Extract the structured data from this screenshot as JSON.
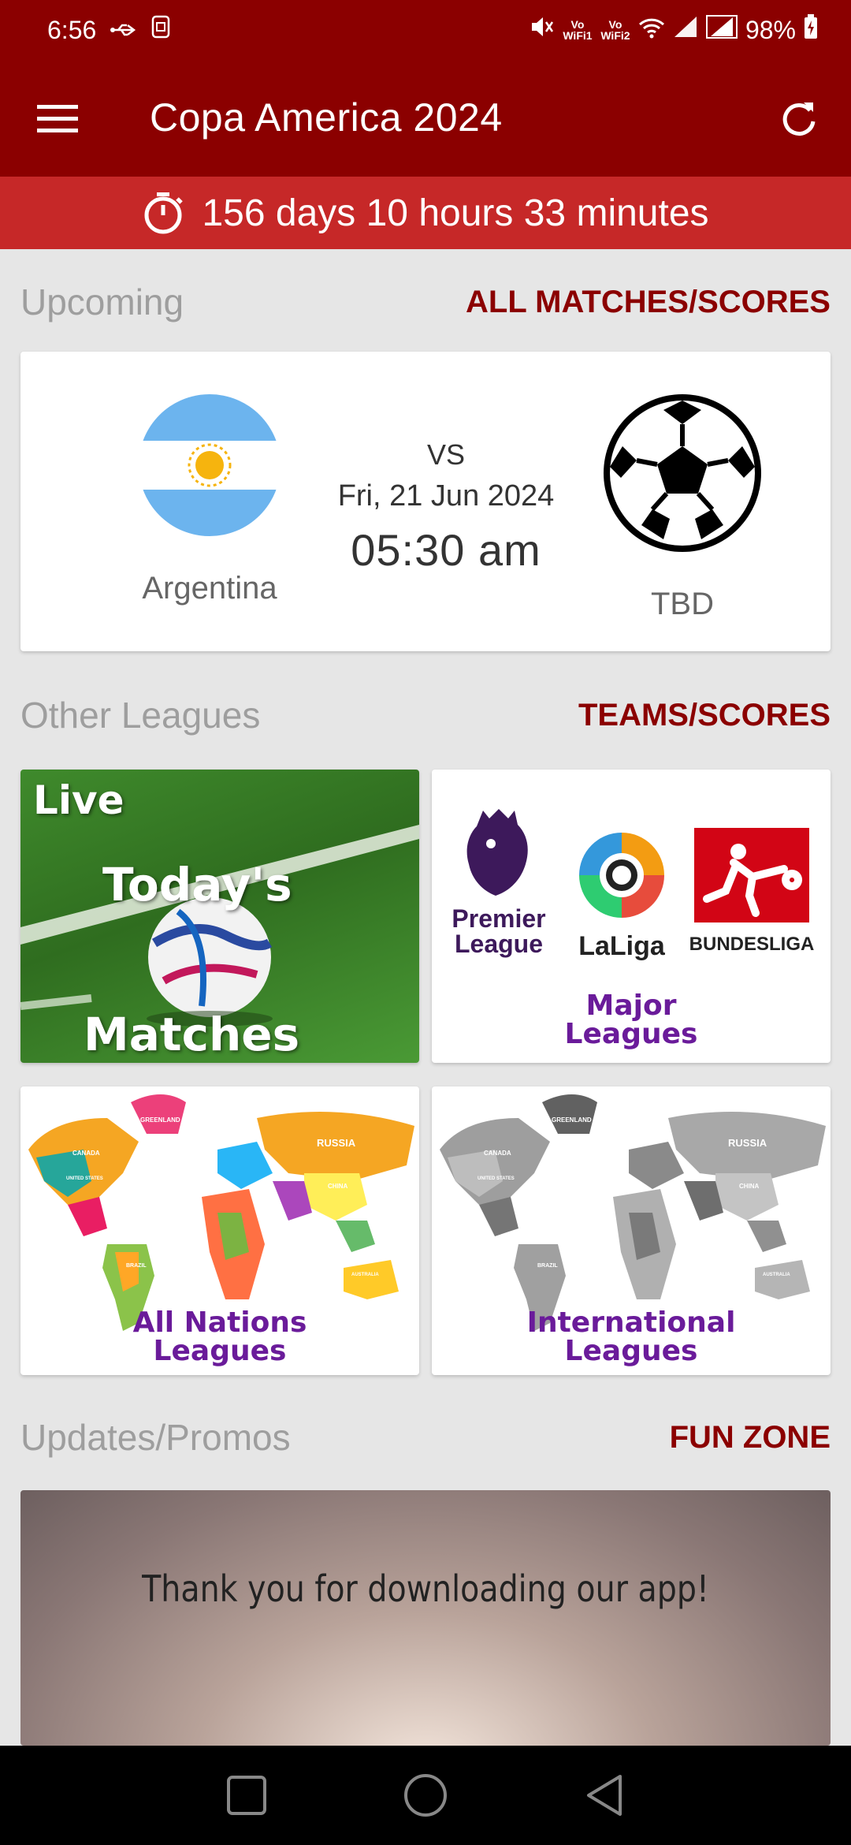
{
  "status_bar": {
    "time": "6:56",
    "battery": "98%",
    "wifi1_label": "Vo WiFi1",
    "wifi2_label": "Vo WiFi2"
  },
  "app_bar": {
    "title": "Copa America 2024"
  },
  "countdown": {
    "text": "156 days 10 hours 33 minutes"
  },
  "upcoming": {
    "section_title": "Upcoming",
    "link_label": "ALL MATCHES/SCORES",
    "match": {
      "home_team": "Argentina",
      "away_team": "TBD",
      "vs": "VS",
      "date": "Fri, 21 Jun 2024",
      "time": "05:30 am"
    }
  },
  "other_leagues": {
    "section_title": "Other Leagues",
    "link_label": "TEAMS/SCORES",
    "tiles": {
      "live": {
        "line1": "Live",
        "line2": "Today's",
        "line3": "Matches"
      },
      "major": {
        "premier_line1": "Premier",
        "premier_line2": "League",
        "laliga": "LaLiga",
        "bundesliga": "BUNDESLIGA",
        "caption_line1": "Major",
        "caption_line2": "Leagues"
      },
      "nations": {
        "caption_line1": "All Nations",
        "caption_line2": "Leagues",
        "map_label_greenland": "GREENLAND",
        "map_label_russia": "RUSSIA",
        "map_label_canada": "CANADA",
        "map_label_usa": "UNITED STATES",
        "map_label_china": "CHINA",
        "map_label_brazil": "BRAZIL",
        "map_label_australia": "AUSTRALIA"
      },
      "international": {
        "caption_line1": "International",
        "caption_line2": "Leagues",
        "map_label_greenland": "GREENLAND",
        "map_label_russia": "RUSSIA",
        "map_label_canada": "CANADA",
        "map_label_usa": "UNITED STATES",
        "map_label_china": "CHINA",
        "map_label_brazil": "BRAZIL",
        "map_label_australia": "AUSTRALIA"
      }
    }
  },
  "updates": {
    "section_title": "Updates/Promos",
    "link_label": "FUN ZONE",
    "promo_text": "Thank you for downloading our app!"
  },
  "colors": {
    "primary": "#8b0000",
    "countdown_bg": "#c62828",
    "caption_purple": "#6a1b9a"
  }
}
